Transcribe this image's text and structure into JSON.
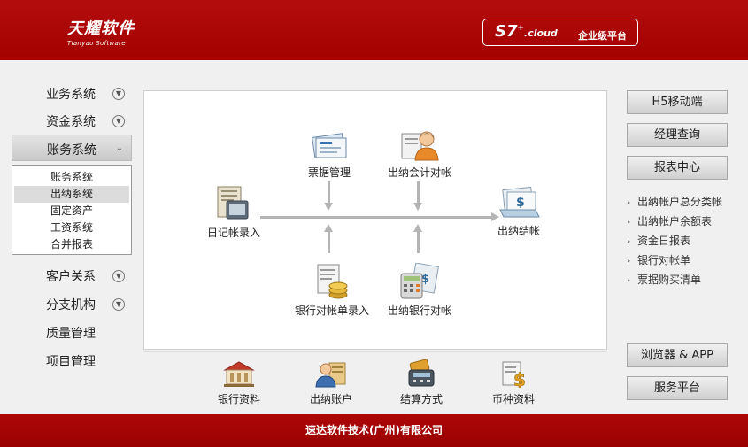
{
  "header": {
    "logo_name": "天耀软件",
    "logo_sub": "Tianyao Software",
    "product_main": "S7",
    "product_sup": "+",
    "product_suffix": ".cloud",
    "product_tag": "企业级平台"
  },
  "sidebar": {
    "items": [
      {
        "label": "业务系统",
        "icon": "chevron-down-circle-icon"
      },
      {
        "label": "资金系统",
        "icon": "chevron-down-circle-icon"
      },
      {
        "label": "账务系统",
        "icon": "chevron-down-icon",
        "active": true
      },
      {
        "label": "客户关系",
        "icon": "chevron-down-circle-icon"
      },
      {
        "label": "分支机构",
        "icon": "chevron-down-circle-icon"
      },
      {
        "label": "质量管理"
      },
      {
        "label": "项目管理"
      }
    ],
    "submenu": [
      {
        "label": "账务系统"
      },
      {
        "label": "出纳系统",
        "selected": true
      },
      {
        "label": "固定资产"
      },
      {
        "label": "工资系统"
      },
      {
        "label": "合并报表"
      }
    ]
  },
  "flow": {
    "nodes": {
      "journal_entry": {
        "label": "日记帐录入",
        "icon": "ledger-book-icon"
      },
      "bill_management": {
        "label": "票据管理",
        "icon": "bills-icon"
      },
      "cashier_accounting_check": {
        "label": "出纳会计对帐",
        "icon": "person-documents-icon"
      },
      "cashier_closing": {
        "label": "出纳结帐",
        "icon": "money-papers-icon"
      },
      "bank_statement_entry": {
        "label": "银行对帐单录入",
        "icon": "document-coins-icon"
      },
      "cashier_bank_check": {
        "label": "出纳银行对帐",
        "icon": "calculator-icon"
      }
    }
  },
  "right_panel": {
    "buttons": {
      "h5_mobile": "H5移动端",
      "manager_query": "经理查询",
      "report_center": "报表中心",
      "browser_app": "浏览器 & APP",
      "service_platform": "服务平台"
    },
    "reports": [
      "出纳帐户总分类帐",
      "出纳帐户余额表",
      "资金日报表",
      "银行对帐单",
      "票据购买清单"
    ]
  },
  "tools": [
    {
      "label": "银行资料",
      "icon": "bank-building-icon"
    },
    {
      "label": "出纳账户",
      "icon": "cashier-account-icon"
    },
    {
      "label": "结算方式",
      "icon": "card-terminal-icon"
    },
    {
      "label": "币种资料",
      "icon": "dollar-document-icon"
    }
  ],
  "footer": {
    "text": "速达软件技术(广州)有限公司"
  },
  "colors": {
    "brand_red": "#a30000",
    "panel_bg": "#ffffff",
    "page_bg": "#f0f0f0",
    "line_gray": "#b4b4b4"
  }
}
